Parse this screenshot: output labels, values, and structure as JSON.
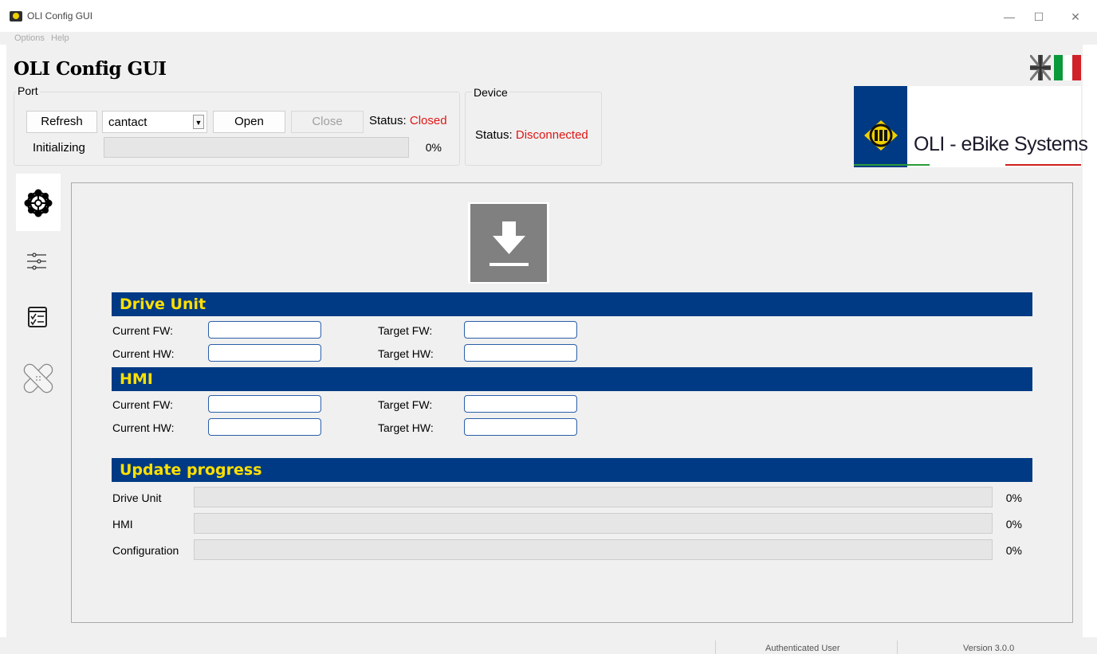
{
  "window": {
    "title": "OLI Config GUI",
    "controls": {
      "minimize": "—",
      "maximize": "☐",
      "close": "✕"
    }
  },
  "menu": [
    "Options",
    "Help"
  ],
  "app": {
    "heading": "OLI Config GUI"
  },
  "port": {
    "group_title": "Port",
    "refresh_label": "Refresh",
    "selected_port": "cantact",
    "open_label": "Open",
    "close_label": "Close",
    "status_label": "Status:",
    "status_value": "Closed",
    "init_label": "Initializing",
    "init_progress": 0,
    "init_percent": "0%"
  },
  "device": {
    "group_title": "Device",
    "status_label": "Status:",
    "status_value": "Disconnected"
  },
  "logo": {
    "text": "OLI - eBike Systems"
  },
  "colors": {
    "section_bar": "#003a84",
    "section_text": "#ffe000",
    "status_red": "#e01515",
    "field_border": "#2a5fa8"
  },
  "sidebar": {
    "tabs": [
      {
        "icon": "gear-icon",
        "active": true
      },
      {
        "icon": "sliders-icon",
        "active": false
      },
      {
        "icon": "checklist-icon",
        "active": false
      },
      {
        "icon": "bandage-icon",
        "active": false
      }
    ]
  },
  "drive_unit": {
    "title": "Drive Unit",
    "current_fw_label": "Current  FW:",
    "current_hw_label": "Current  HW:",
    "target_fw_label": "Target FW:",
    "target_hw_label": "Target HW:",
    "current_fw": "",
    "current_hw": "",
    "target_fw": "",
    "target_hw": ""
  },
  "hmi": {
    "title": "HMI",
    "current_fw_label": "Current  FW:",
    "current_hw_label": "Current  HW:",
    "target_fw_label": "Target FW:",
    "target_hw_label": "Target HW:",
    "current_fw": "",
    "current_hw": "",
    "target_fw": "",
    "target_hw": ""
  },
  "update_progress": {
    "title": "Update progress",
    "rows": [
      {
        "label": "Drive Unit",
        "progress": 0,
        "percent": "0%"
      },
      {
        "label": "HMI",
        "progress": 0,
        "percent": "0%"
      },
      {
        "label": "Configuration",
        "progress": 0,
        "percent": "0%"
      }
    ]
  },
  "statusbar": {
    "user": "Authenticated User",
    "version": "Version 3.0.0"
  }
}
